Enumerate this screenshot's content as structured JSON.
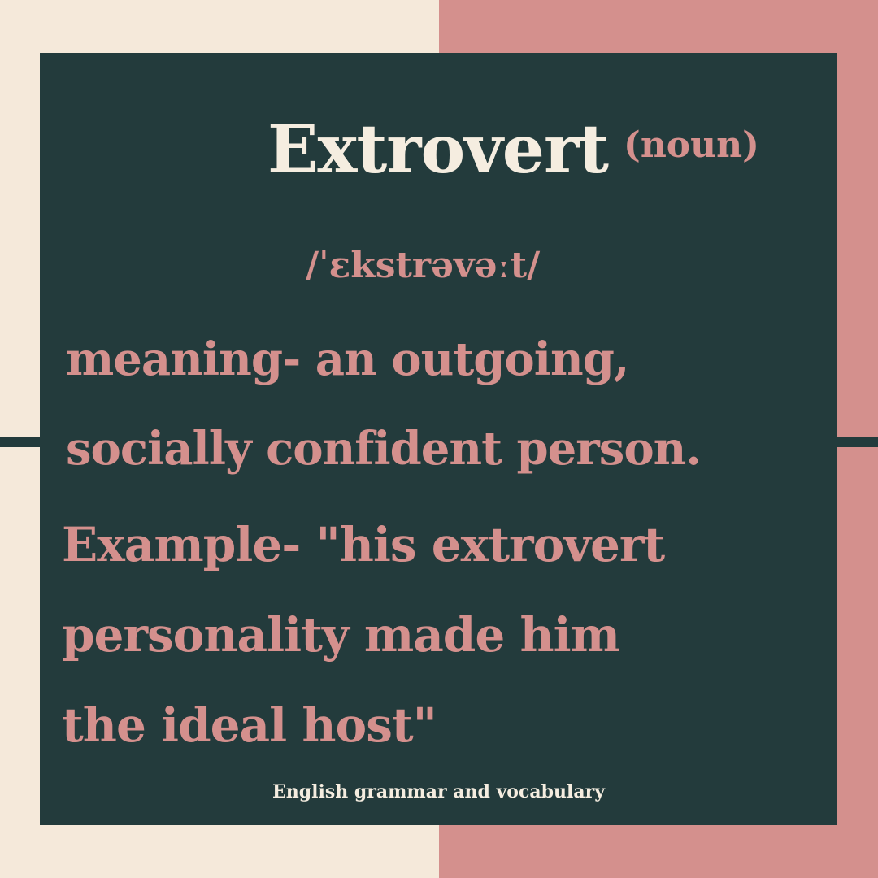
{
  "colors": {
    "background_left": "#f5e9da",
    "background_right": "#d4908d",
    "card": "#233b3c",
    "headword": "#f5ede0",
    "accent_pink": "#d4908d",
    "footer_text": "#f5ede0"
  },
  "entry": {
    "word": "Extrovert",
    "part_of_speech": "(noun)",
    "pronunciation": "/ˈɛkstrəvəːt/",
    "meaning_lines": [
      "meaning- an outgoing,",
      "socially confident person."
    ],
    "example_lines": [
      "Example- \"his extrovert",
      "personality made him",
      "the ideal host\""
    ]
  },
  "footer": {
    "text": "English grammar and vocabulary"
  }
}
